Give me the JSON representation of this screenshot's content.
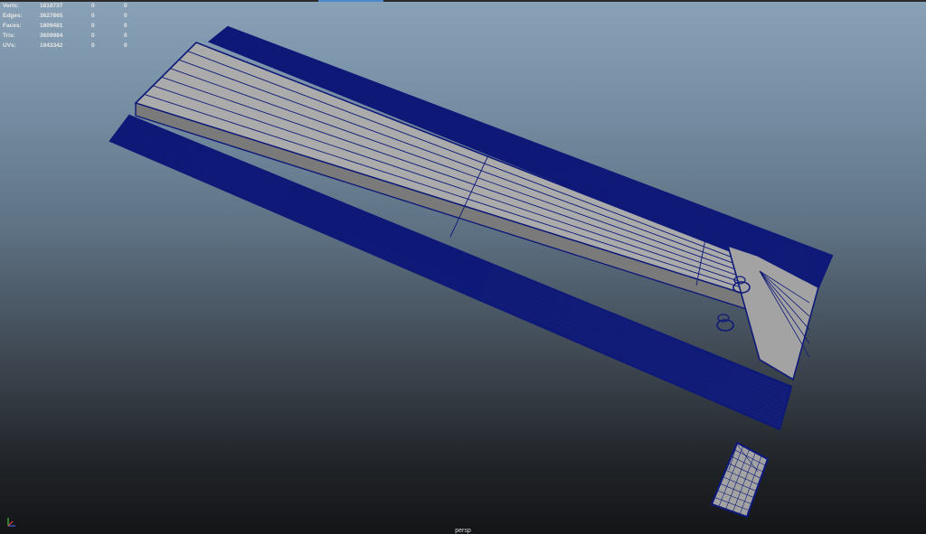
{
  "hud": {
    "rows": [
      {
        "label": "Verts:",
        "v1": "1818737",
        "v2": "0",
        "v3": "0"
      },
      {
        "label": "Edges:",
        "v1": "3627865",
        "v2": "0",
        "v3": "0"
      },
      {
        "label": "Faces:",
        "v1": "1809481",
        "v2": "0",
        "v3": "0"
      },
      {
        "label": "Tris:",
        "v1": "3609984",
        "v2": "0",
        "v3": "0"
      },
      {
        "label": "UVs:",
        "v1": "1943342",
        "v2": "0",
        "v3": "0"
      }
    ]
  },
  "viewport": {
    "camera": "persp",
    "colors": {
      "wire": "#0f1a78",
      "face": "#a3a3a3",
      "face_top": "#ababab",
      "face_side": "#7a7a7a"
    }
  },
  "axis_gizmo": {
    "x": "#e04040",
    "y": "#40c040",
    "z": "#4060e0"
  }
}
